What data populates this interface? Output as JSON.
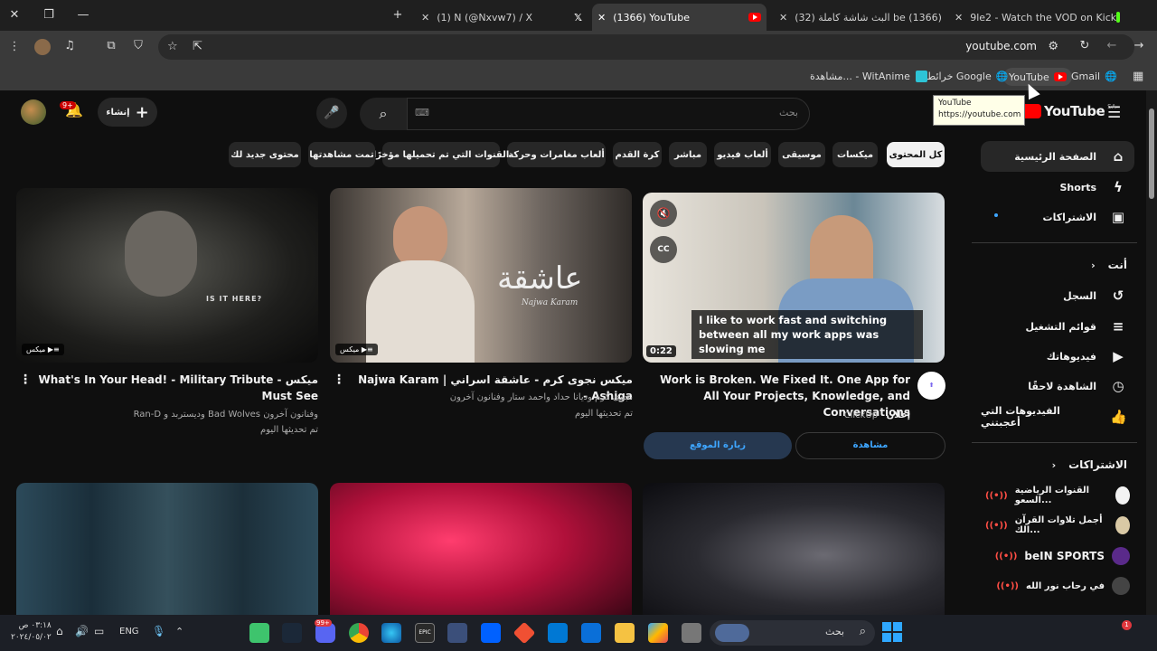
{
  "browser": {
    "tabs": [
      {
        "title": "(1) N (@Nxvw7) / X",
        "icon": "x-logo"
      },
      {
        "title": "(1366) YouTube",
        "icon": "youtube-favicon",
        "active": true
      },
      {
        "title": "be (1366) البث شاشة كاملة (32)",
        "icon": "youtube-favicon"
      },
      {
        "title": "9le2 - Watch the VOD on Kick",
        "icon": "kick-logo"
      }
    ],
    "url": "youtube.com",
    "bookmarks": [
      "YouTube",
      "Gmail",
      "خرائط Google",
      "مشاهدة... - WitAnime"
    ],
    "tooltip": {
      "title": "YouTube",
      "url": "https://youtube.com"
    }
  },
  "yt": {
    "logo_text": "YouTube",
    "region": "SA",
    "search_placeholder": "بحث",
    "create_label": "إنشاء",
    "notif_count": "9+",
    "accent": "#ff0000",
    "chips": [
      "كل المحتوى",
      "ميكسات",
      "موسيقى",
      "ألعاب فيديو",
      "مباشر",
      "كرة القدم",
      "ألعاب مغامرات وحركة",
      "القنوات التي تم تحميلها مؤخرًا",
      "تمت مشاهدتها",
      "محتوى جديد لك"
    ],
    "sidebar": {
      "main": [
        {
          "label": "الصفحة الرئيسية",
          "icon": "home-icon"
        },
        {
          "label": "Shorts",
          "icon": "shorts-icon"
        },
        {
          "label": "الاشتراكات",
          "icon": "subscriptions-icon"
        }
      ],
      "you_header": "أنت",
      "you": [
        {
          "label": "السجل",
          "icon": "history-icon"
        },
        {
          "label": "قوائم التشغيل",
          "icon": "playlist-icon"
        },
        {
          "label": "فيديوهاتك",
          "icon": "your-videos-icon"
        },
        {
          "label": "الشاهدة لاحقًا",
          "icon": "watch-later-icon"
        },
        {
          "label": "الفيديوهات التي أعجبتني",
          "icon": "like-icon"
        }
      ],
      "subs_header": "الاشتراكات",
      "subs": [
        {
          "label": "القنوات الرياضية السعو..."
        },
        {
          "label": "أجمل تلاوات القرآن الك..."
        },
        {
          "label": "beIN SPORTS"
        },
        {
          "label": "في رحاب نور الله"
        }
      ]
    },
    "videos": [
      {
        "title": "Work is Broken. We Fixed It. One App for All Your Projects, Knowledge, and Conversations",
        "channel": "ClickUp",
        "meta1": "إعلان",
        "duration": "0:22",
        "caption": "I like to work fast and switching between all my work apps was slowing me",
        "btn_visit": "زيارة الموقع",
        "btn_watch": "مشاهدة",
        "cc": "CC"
      },
      {
        "title": "ميكس نجوى كرم - عاشقة اسراني | Najwa Karam - Ashiga",
        "meta1": "نجوى كرم وديانا حداد واحمد ستار وفنانون آخرون",
        "meta2": "تم تحديثها اليوم",
        "badge": "ميكس",
        "overlay_ar": "عاشقة",
        "overlay_en": "Najwa Karam"
      },
      {
        "title": "ميكس What's In Your Head! - Military Tribute - Must See",
        "meta1": "وفنانون آخرون Bad Wolves وديستربد و Ran-D",
        "meta2": "تم تحديثها اليوم",
        "badge": "ميكس",
        "overlay_en": "IS IT HERE?"
      }
    ]
  },
  "taskbar": {
    "search_placeholder": "بحث",
    "lang": "ENG",
    "time": "٠٣:١٨ ص",
    "date": "٢٠٢٤/٠٥/٠٢",
    "notif": "1",
    "discord_badge": "99+"
  }
}
